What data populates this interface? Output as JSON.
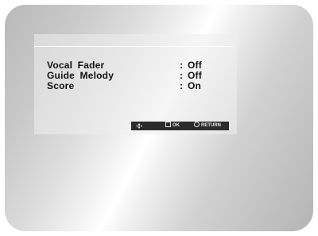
{
  "menu": {
    "items": [
      {
        "label": "Vocal  Fader",
        "colon": ":",
        "value": "Off"
      },
      {
        "label": "Guide  Melody",
        "colon": ":",
        "value": "Off"
      },
      {
        "label": "Score",
        "colon": ":",
        "value": "On"
      }
    ]
  },
  "footer": {
    "nav_icon": "navigation-arrows-icon",
    "ok_icon": "enter-icon",
    "ok_label": "OK",
    "return_icon": "return-icon",
    "return_label": "RETURN"
  },
  "colors": {
    "footer_bg": "#2b2b2b",
    "text": "#111111"
  }
}
